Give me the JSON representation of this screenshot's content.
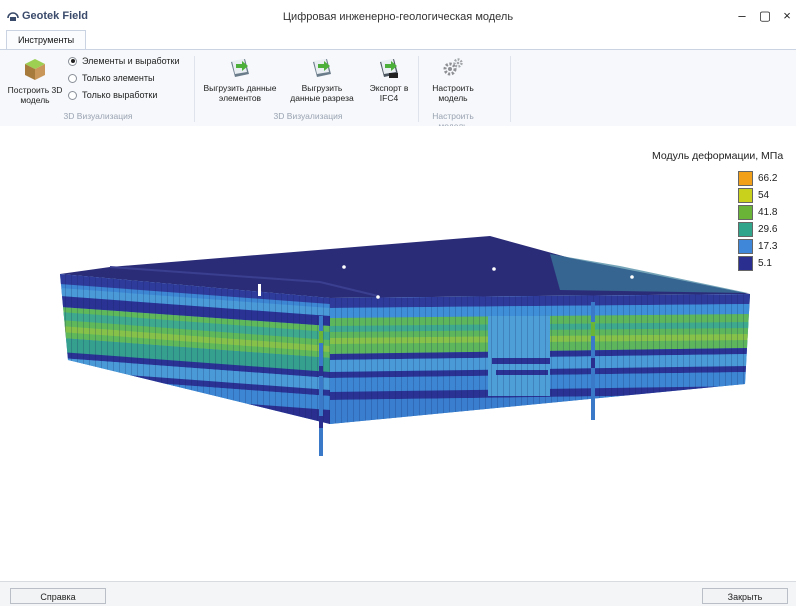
{
  "window": {
    "app_name": "Geotek Field",
    "title": "Цифровая инженерно-геологическая модель",
    "minimize_glyph": "–",
    "maximize_glyph": "▢",
    "close_glyph": "×"
  },
  "ribbon": {
    "active_tab": "Инструменты",
    "build_label": "Построить 3D модель",
    "radio_options": [
      {
        "label": "Элементы и выработки",
        "selected": true
      },
      {
        "label": "Только элементы",
        "selected": false
      },
      {
        "label": "Только выработки",
        "selected": false
      }
    ],
    "export_elements_label": "Выгрузить данные элементов",
    "export_section_label": "Выгрузить данные разреза",
    "export_ifc_label": "Экспорт в IFC4",
    "configure_label": "Настроить модель",
    "groups": [
      "3D Визуализация",
      "3D Визуализация",
      "Настроить модель"
    ]
  },
  "legend": {
    "title": "Модуль деформации, МПа",
    "items": [
      {
        "value": "66.2",
        "color": "#f2a01a"
      },
      {
        "value": "54",
        "color": "#c9d11c"
      },
      {
        "value": "41.8",
        "color": "#6ab437"
      },
      {
        "value": "29.6",
        "color": "#30a58c"
      },
      {
        "value": "17.3",
        "color": "#3f87d8"
      },
      {
        "value": "5.1",
        "color": "#2a2f8f"
      }
    ]
  },
  "footer": {
    "help_label": "Справка",
    "close_label": "Закрыть"
  }
}
